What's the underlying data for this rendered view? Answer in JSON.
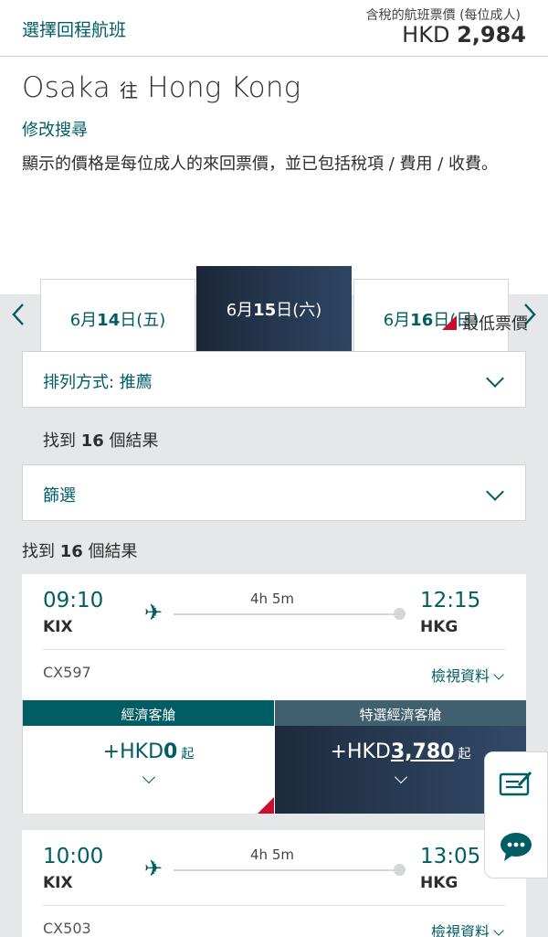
{
  "topbar": {
    "title": "選擇回程航班",
    "price_note": "含稅的航班票價 (每位成人)",
    "price_currency": "HKD",
    "price_value": "2,984"
  },
  "header": {
    "origin": "Osaka",
    "to_word": "往",
    "destination": "Hong Kong",
    "modify_link": "修改搜尋",
    "notice": "顯示的價格是每位成人的來回票價，並已包括稅項 / 費用 / 收費。"
  },
  "dates": {
    "tabs": [
      {
        "month_day_a": "6月",
        "day": "14",
        "suffix": "日(五)"
      },
      {
        "month_day_a": "6月",
        "day": "15",
        "suffix": "日(六)"
      },
      {
        "month_day_a": "6月",
        "day": "16",
        "suffix": "日(日)"
      }
    ]
  },
  "legend": {
    "lowest_fare": "最低票價"
  },
  "sort": {
    "label": "排列方式: 推薦"
  },
  "results1": {
    "prefix": "找到",
    "count": "16",
    "suffix": "個結果"
  },
  "filter": {
    "label": "篩選"
  },
  "results2": {
    "prefix": "找到",
    "count": "16",
    "suffix": "個結果"
  },
  "flights": [
    {
      "dep_time": "09:10",
      "dep_airport": "KIX",
      "arr_time": "12:15",
      "arr_airport": "HKG",
      "duration": "4h 5m",
      "flight_no": "CX597",
      "details_label": "檢視資料",
      "economy": {
        "header": "經濟客艙",
        "prefix": "+HKD",
        "amount": "0",
        "from": "起"
      },
      "premium": {
        "header": "特選經濟客艙",
        "prefix": "+HKD",
        "amount": "3,780",
        "from": "起"
      }
    },
    {
      "dep_time": "10:00",
      "dep_airport": "KIX",
      "arr_time": "13:05",
      "arr_airport": "HKG",
      "duration": "4h 5m",
      "flight_no": "CX503",
      "details_label": "檢視資料"
    }
  ],
  "colors": {
    "brand_teal": "#005d63",
    "lowest_red": "#c8102e",
    "navy": "#1d2a3d"
  },
  "icons": [
    "chevron-left-icon",
    "chevron-right-icon",
    "plane-icon",
    "chevron-down-icon",
    "feedback-icon",
    "chat-icon"
  ]
}
